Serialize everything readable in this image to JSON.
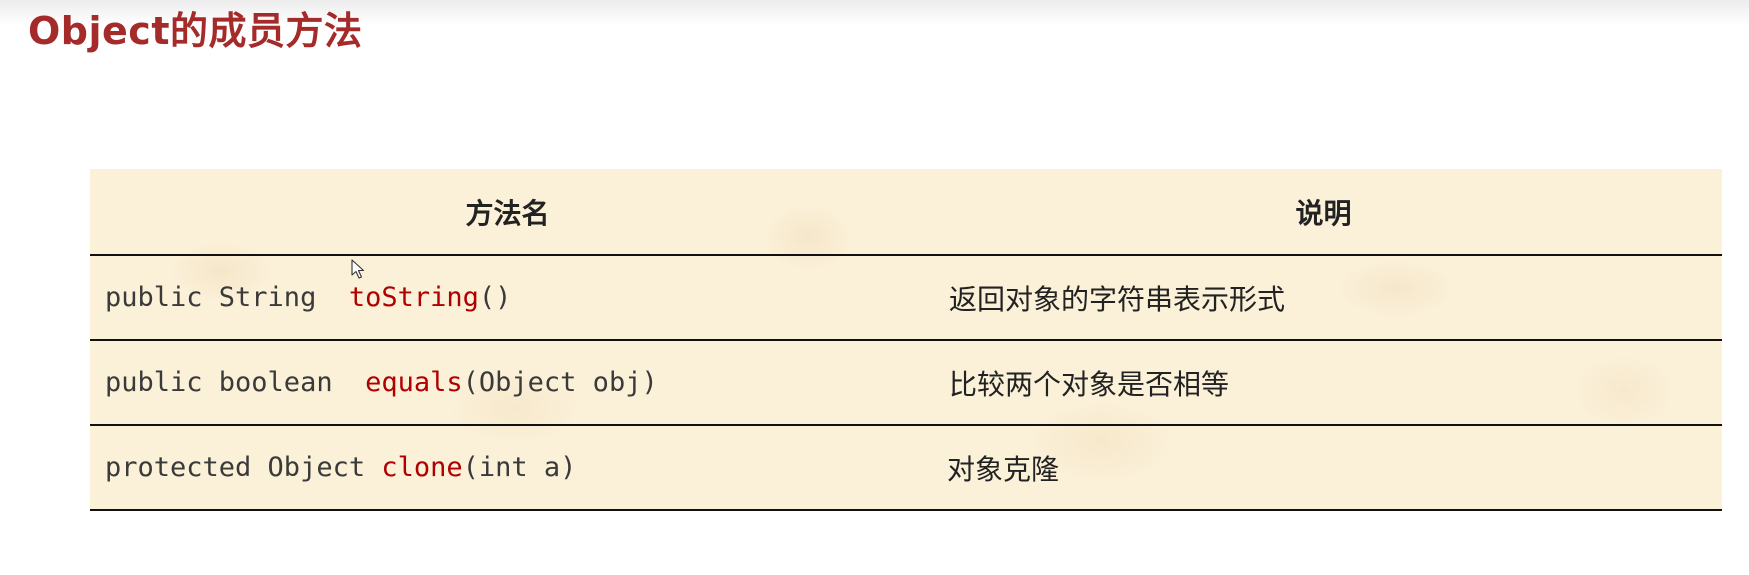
{
  "page": {
    "title": "Object的成员方法"
  },
  "table": {
    "headers": {
      "method": "方法名",
      "description": "说明"
    },
    "rows": [
      {
        "prefix": "public String  ",
        "name": "toString",
        "params": "()",
        "description": "返回对象的字符串表示形式"
      },
      {
        "prefix": "public boolean  ",
        "name": "equals",
        "params": "(Object obj)",
        "description": "比较两个对象是否相等"
      },
      {
        "prefix": "protected Object ",
        "name": "clone",
        "params": "(int a)",
        "description": "对象克隆"
      }
    ]
  },
  "colors": {
    "title": "#a52a2a",
    "method_name": "#b00000",
    "table_background": "#fbf0d8",
    "row_border": "#111111"
  },
  "icons": {
    "cursor": "mouse-pointer-icon"
  }
}
